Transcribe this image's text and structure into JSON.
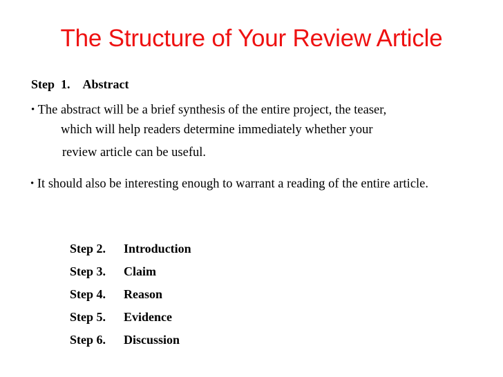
{
  "slide": {
    "title": "The Structure of Your Review Article",
    "title_color": "#ee1111",
    "background_color": "#ffffff",
    "heading": {
      "label": "Step  1. Abstract",
      "step_label": "Step  1.",
      "step_title": "Abstract"
    },
    "bullets": [
      {
        "marker": "•",
        "lines": [
          "The abstract will be a brief synthesis of the entire project, the teaser,",
          "which will help readers determine immediately whether your",
          "review article can be useful."
        ]
      },
      {
        "marker": "•",
        "text": "It should also be interesting enough to warrant a reading of the entire article."
      }
    ],
    "steps": [
      {
        "number": "Step 2.",
        "name": "Introduction"
      },
      {
        "number": "Step 3.",
        "name": "Claim"
      },
      {
        "number": "Step 4.",
        "name": "Reason"
      },
      {
        "number": "Step 5.",
        "name": "Evidence"
      },
      {
        "number": "Step 6.",
        "name": "Discussion"
      }
    ]
  }
}
